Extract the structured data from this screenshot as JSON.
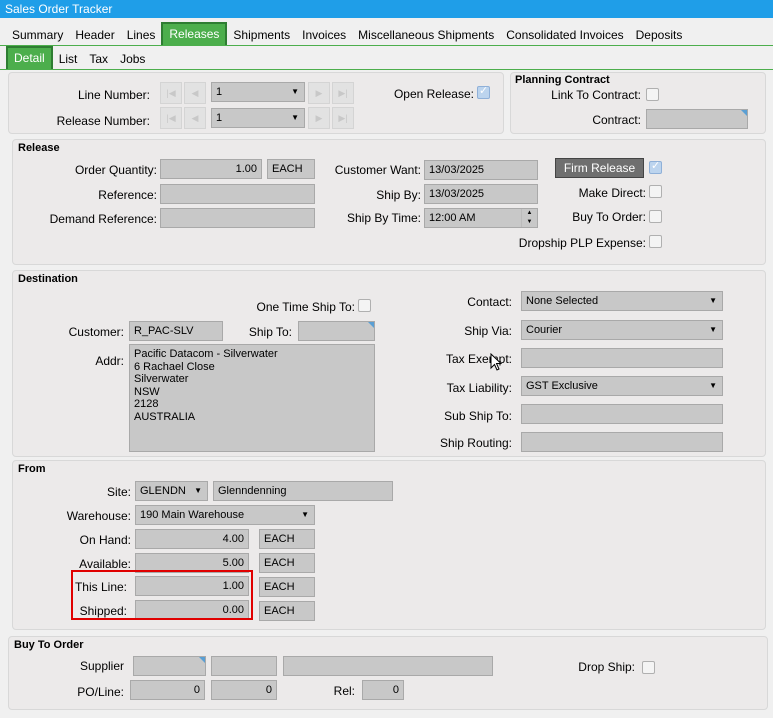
{
  "window": {
    "title": "Sales Order Tracker"
  },
  "main_tabs": [
    "Summary",
    "Header",
    "Lines",
    "Releases",
    "Shipments",
    "Invoices",
    "Miscellaneous Shipments",
    "Consolidated Invoices",
    "Deposits"
  ],
  "sub_tabs": [
    "Detail",
    "List",
    "Tax",
    "Jobs"
  ],
  "top": {
    "line_number_label": "Line Number:",
    "line_number_value": "1",
    "release_number_label": "Release Number:",
    "release_number_value": "1",
    "open_release_label": "Open Release:"
  },
  "planning": {
    "title": "Planning Contract",
    "link_label": "Link To Contract:",
    "contract_label": "Contract:",
    "contract_value": ""
  },
  "release": {
    "title": "Release",
    "order_qty_label": "Order Quantity:",
    "order_qty_value": "1.00",
    "order_qty_uom": "EACH",
    "reference_label": "Reference:",
    "reference_value": "",
    "demand_ref_label": "Demand Reference:",
    "demand_ref_value": "",
    "customer_want_label": "Customer Want:",
    "customer_want_value": "13/03/2025",
    "ship_by_label": "Ship By:",
    "ship_by_value": "13/03/2025",
    "ship_by_time_label": "Ship By Time:",
    "ship_by_time_value": "12:00 AM",
    "firm_release_label": "Firm Release",
    "make_direct_label": "Make Direct:",
    "buy_to_order_label": "Buy To Order:",
    "dropship_label": "Dropship PLP Expense:"
  },
  "destination": {
    "title": "Destination",
    "one_time_label": "One Time Ship To:",
    "customer_label": "Customer:",
    "customer_value": "R_PAC-SLV",
    "ship_to_label": "Ship To:",
    "ship_to_value": "",
    "addr_label": "Addr:",
    "addr_lines": [
      "Pacific Datacom - Silverwater",
      "6 Rachael Close",
      "Silverwater",
      "NSW",
      "2128",
      "AUSTRALIA"
    ],
    "contact_label": "Contact:",
    "contact_value": "None Selected",
    "ship_via_label": "Ship Via:",
    "ship_via_value": "Courier",
    "tax_exempt_label": "Tax Exempt:",
    "tax_exempt_value": "",
    "tax_liability_label": "Tax Liability:",
    "tax_liability_value": "GST Exclusive",
    "sub_ship_to_label": "Sub Ship To:",
    "sub_ship_to_value": "",
    "ship_routing_label": "Ship Routing:",
    "ship_routing_value": ""
  },
  "from": {
    "title": "From",
    "site_label": "Site:",
    "site_value": "GLENDN",
    "site_name": "Glenndenning",
    "warehouse_label": "Warehouse:",
    "warehouse_value": "190 Main Warehouse",
    "on_hand_label": "On Hand:",
    "on_hand_value": "4.00",
    "on_hand_uom": "EACH",
    "available_label": "Available:",
    "available_value": "5.00",
    "available_uom": "EACH",
    "this_line_label": "This Line:",
    "this_line_value": "1.00",
    "this_line_uom": "EACH",
    "shipped_label": "Shipped:",
    "shipped_value": "0.00",
    "shipped_uom": "EACH"
  },
  "buy_to_order": {
    "title": "Buy To Order",
    "supplier_label": "Supplier",
    "drop_ship_label": "Drop Ship:",
    "po_line_label": "PO/Line:",
    "po_value": "0",
    "line_value": "0",
    "rel_label": "Rel:",
    "rel_value": "0"
  }
}
